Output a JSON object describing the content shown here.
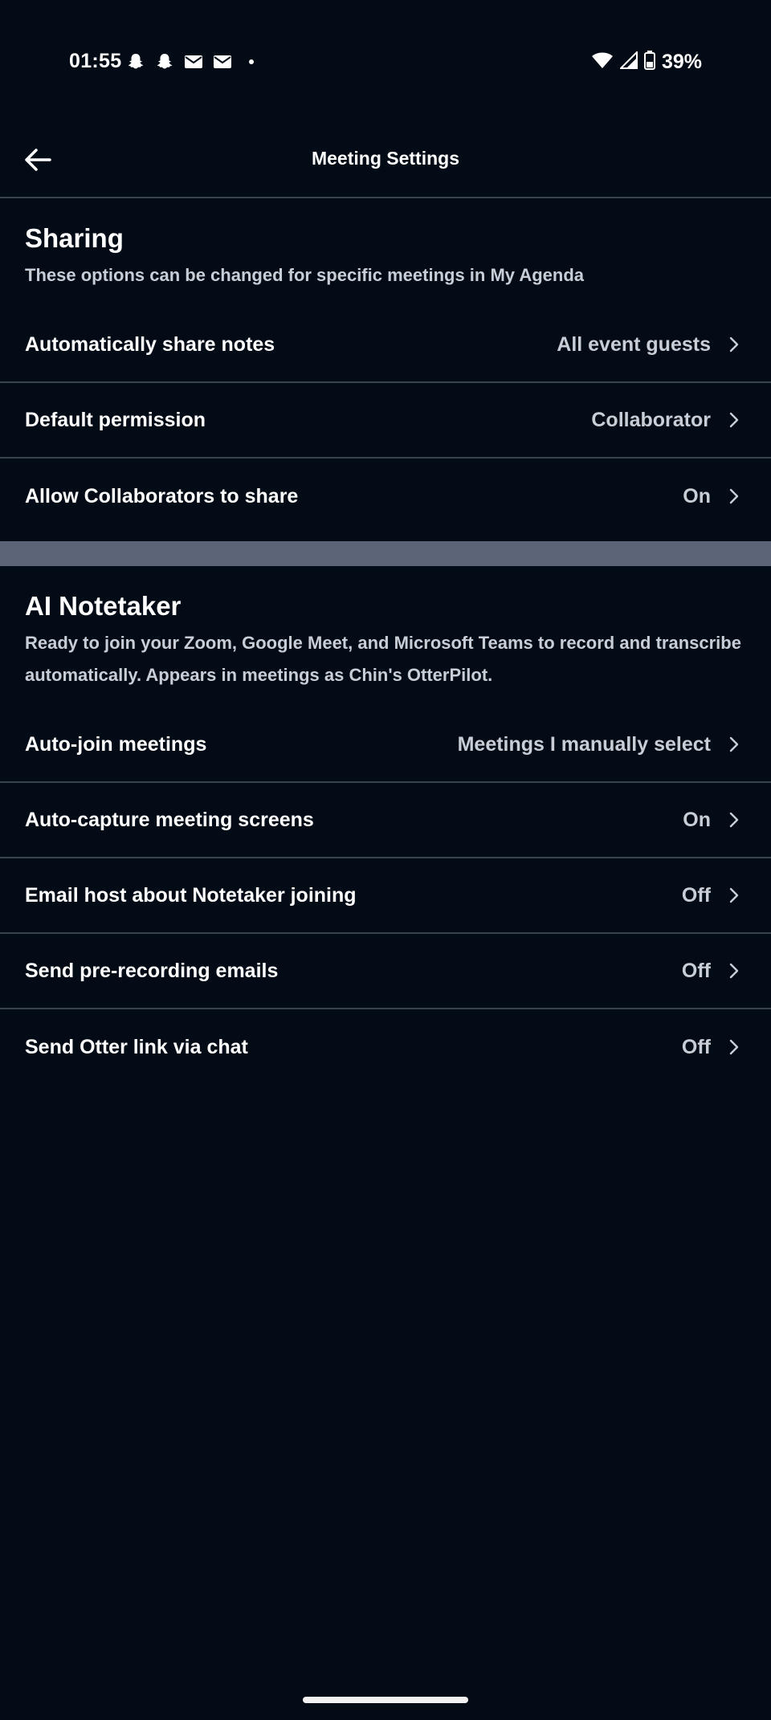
{
  "status_bar": {
    "time": "01:55",
    "battery": "39%",
    "left_icons": [
      "snapchat-icon",
      "snapchat-icon",
      "mail-icon",
      "mail-icon",
      "dot-icon"
    ],
    "right_icons": [
      "wifi-icon",
      "signal-icon",
      "battery-icon"
    ]
  },
  "app_bar": {
    "title": "Meeting Settings",
    "back_icon": "arrow-left-icon"
  },
  "sharing": {
    "title": "Sharing",
    "description": "These options can be changed for specific meetings in My Agenda",
    "rows": [
      {
        "label": "Automatically share notes",
        "value": "All event guests"
      },
      {
        "label": "Default permission",
        "value": "Collaborator"
      },
      {
        "label": "Allow Collaborators to share",
        "value": "On"
      }
    ]
  },
  "notetaker": {
    "title": "AI Notetaker",
    "description": "Ready to join your Zoom, Google Meet, and Microsoft Teams to record and transcribe automatically. Appears in meetings as Chin's OtterPilot.",
    "rows": [
      {
        "label": "Auto-join meetings",
        "value": "Meetings I manually select"
      },
      {
        "label": "Auto-capture meeting screens",
        "value": "On"
      },
      {
        "label": "Email host about Notetaker joining",
        "value": "Off"
      },
      {
        "label": "Send pre-recording emails",
        "value": "Off"
      },
      {
        "label": "Send Otter link via chat",
        "value": "Off"
      }
    ]
  },
  "colors": {
    "background": "#030b16",
    "divider": "#3a4350",
    "section_separator": "#5b6577",
    "secondary_text": "#c9ced6"
  }
}
